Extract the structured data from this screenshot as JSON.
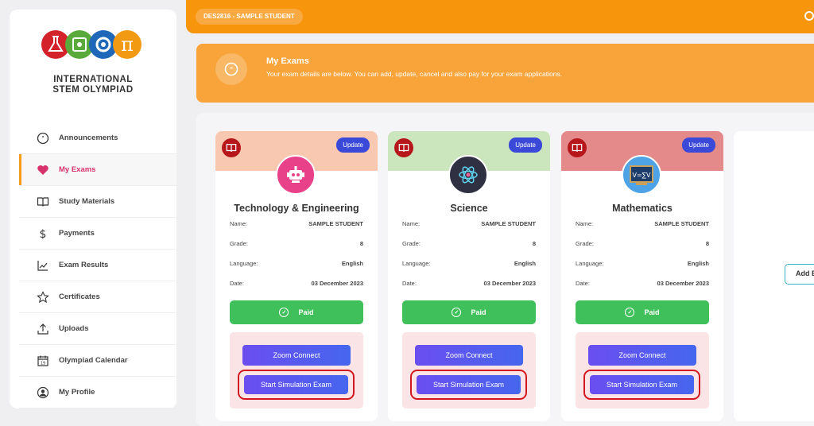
{
  "logo": {
    "line1": "INTERNATIONAL",
    "line2": "STEM OLYMPIAD"
  },
  "sidebar": {
    "items": [
      {
        "label": "Announcements",
        "icon": "chat-bubble-icon"
      },
      {
        "label": "My Exams",
        "icon": "heart-icon",
        "active": true
      },
      {
        "label": "Study Materials",
        "icon": "book-open-icon"
      },
      {
        "label": "Payments",
        "icon": "dollar-icon"
      },
      {
        "label": "Exam Results",
        "icon": "chart-line-icon"
      },
      {
        "label": "Certificates",
        "icon": "star-icon"
      },
      {
        "label": "Uploads",
        "icon": "upload-icon"
      },
      {
        "label": "Olympiad Calendar",
        "icon": "calendar-icon"
      },
      {
        "label": "My Profile",
        "icon": "user-circle-icon"
      }
    ]
  },
  "topbar": {
    "student": "DES2816 - SAMPLE STUDENT"
  },
  "banner": {
    "title": "My Exams",
    "description": "Your exam details are below. You can add, update, cancel and also pay for your exam applications."
  },
  "labels": {
    "update": "Update",
    "name": "Name:",
    "grade": "Grade:",
    "language": "Language:",
    "date": "Date:",
    "paid": "Paid",
    "zoom": "Zoom Connect",
    "simulation": "Start Simulation Exam",
    "add": "Add E"
  },
  "exams": [
    {
      "subject": "Technology & Engineering",
      "name": "SAMPLE STUDENT",
      "grade": "8",
      "language": "English",
      "date": "03 December 2023",
      "header_color": "#f9c8b0",
      "avatar_color": "#e8418a",
      "avatar_icon": "robot-icon"
    },
    {
      "subject": "Science",
      "name": "SAMPLE STUDENT",
      "grade": "8",
      "language": "English",
      "date": "03 December 2023",
      "header_color": "#cbe5bc",
      "avatar_color": "#2f3041",
      "avatar_icon": "atom-icon"
    },
    {
      "subject": "Mathematics",
      "name": "SAMPLE STUDENT",
      "grade": "8",
      "language": "English",
      "date": "03 December 2023",
      "header_color": "#e58a8a",
      "avatar_color": "#1e67b9",
      "avatar_icon": "chalkboard-icon"
    }
  ],
  "colors": {
    "brand_orange": "#f7960d",
    "update_blue": "#3b49d8",
    "paid_green": "#40c05a",
    "highlight_red": "#d3171f"
  }
}
